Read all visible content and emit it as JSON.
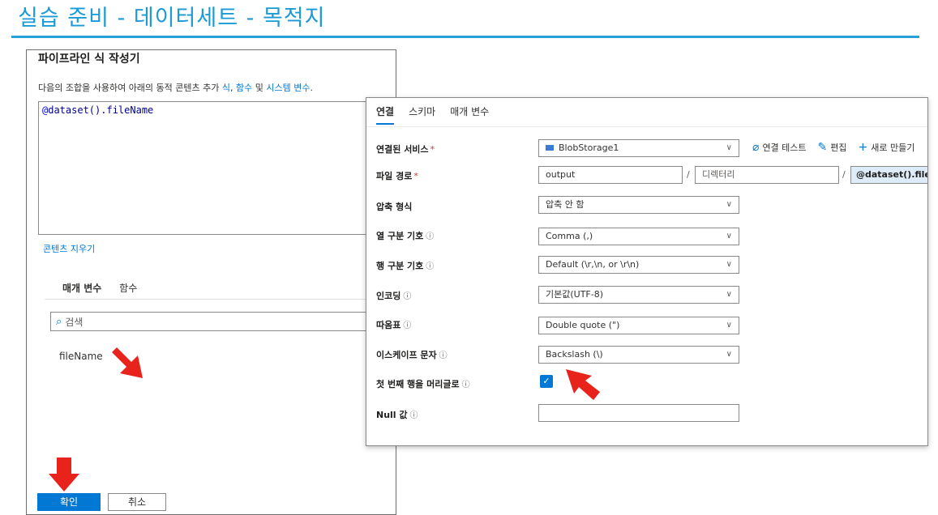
{
  "slide": {
    "title": "실습 준비 - 데이터세트 - 목적지"
  },
  "builder": {
    "title": "파이프라인 식 작성기",
    "desc_prefix": "다음의 조합을 사용하여 아래의 동적 콘텐츠 추가 ",
    "desc_link1": "식",
    "desc_sep": ", ",
    "desc_link2": "함수",
    "desc_and": " 및 ",
    "desc_link3": "시스템 변수",
    "desc_end": ".",
    "expr_at": "@",
    "expr_rest": "dataset().fileName",
    "clear_label": "콘텐츠 지우기",
    "tabs": [
      "매개 변수",
      "함수"
    ],
    "search_placeholder": "검색",
    "params": [
      "fileName"
    ],
    "ok_label": "확인",
    "cancel_label": "취소"
  },
  "connection": {
    "tabs": [
      "연결",
      "스키마",
      "매개 변수"
    ],
    "actions": {
      "test": "연결 테스트",
      "edit": "편집",
      "new": "새로 만들기"
    },
    "rows": [
      {
        "label": "연결된 서비스",
        "required": "*",
        "value": "BlobStorage1"
      },
      {
        "label": "파일 경로",
        "required": "*",
        "container": "output",
        "directory_placeholder": "디렉터리",
        "file": "@dataset().fileName"
      },
      {
        "label": "압축 형식",
        "value": "압축 안 함"
      },
      {
        "label": "열 구분 기호",
        "info": "ⓘ",
        "value": "Comma (,)"
      },
      {
        "label": "행 구분 기호",
        "info": "ⓘ",
        "value": "Default (\\r,\\n, or \\r\\n)"
      },
      {
        "label": "인코딩",
        "info": "ⓘ",
        "value": "기본값(UTF-8)"
      },
      {
        "label": "따옴표",
        "info": "ⓘ",
        "value": "Double quote (\")"
      },
      {
        "label": "이스케이프 문자",
        "info": "ⓘ",
        "value": "Backslash (\\)"
      },
      {
        "label": "첫 번째 행을 머리글로",
        "info": "ⓘ",
        "checked": true
      },
      {
        "label": "Null 값",
        "info": "ⓘ",
        "value": ""
      }
    ]
  },
  "colors": {
    "accent": "#0078d4",
    "title": "#1a9ad6",
    "arrow": "#e8231b"
  }
}
